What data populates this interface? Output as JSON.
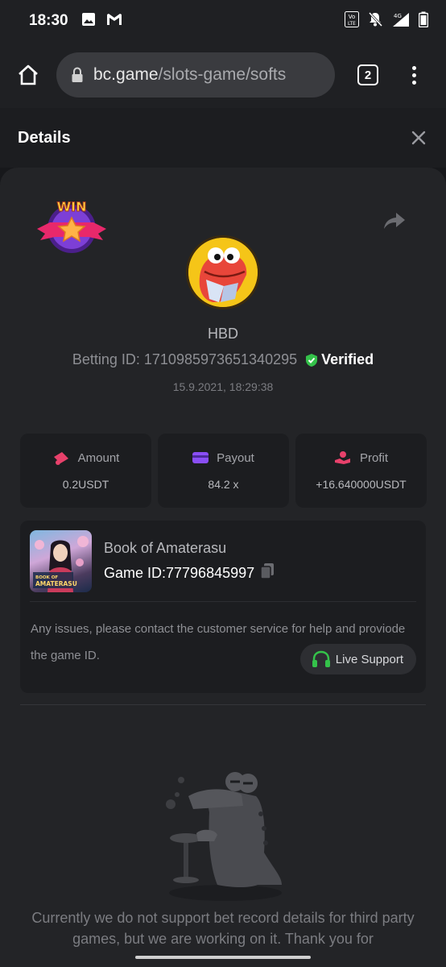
{
  "status_bar": {
    "time": "18:30",
    "network_label": "4G",
    "volte_label": "VoLTE"
  },
  "browser": {
    "url_host": "bc.game",
    "url_path": "/slots-game/softs",
    "tab_count": "2"
  },
  "details": {
    "title": "Details"
  },
  "bet": {
    "win_label": "WIN",
    "username": "HBD",
    "betting_id_label": "Betting ID: 1710985973651340295",
    "verified_label": "Verified",
    "date": "15.9.2021, 18:29:38"
  },
  "stats": [
    {
      "label": "Amount",
      "value": "0.2USDT",
      "icon": "amount-icon",
      "color": "#e8416b"
    },
    {
      "label": "Payout",
      "value": "84.2 x",
      "icon": "payout-icon",
      "color": "#8a4ef5"
    },
    {
      "label": "Profit",
      "value": "+16.640000USDT",
      "icon": "profit-icon",
      "color": "#e8416b"
    }
  ],
  "game": {
    "name": "Book of Amaterasu",
    "game_id": "Game ID:77796845997",
    "thumb_caption": "BOOK OF AMATERASU",
    "issue_text": "Any issues, please contact the customer service for help and proviode the game ID.",
    "live_support": "Live Support"
  },
  "bottom_message": "Currently we do not support bet record details for third party games, but we are working on it. Thank you for",
  "colors": {
    "accent_green": "#34c24a",
    "background": "#17181b",
    "card": "#232427"
  }
}
